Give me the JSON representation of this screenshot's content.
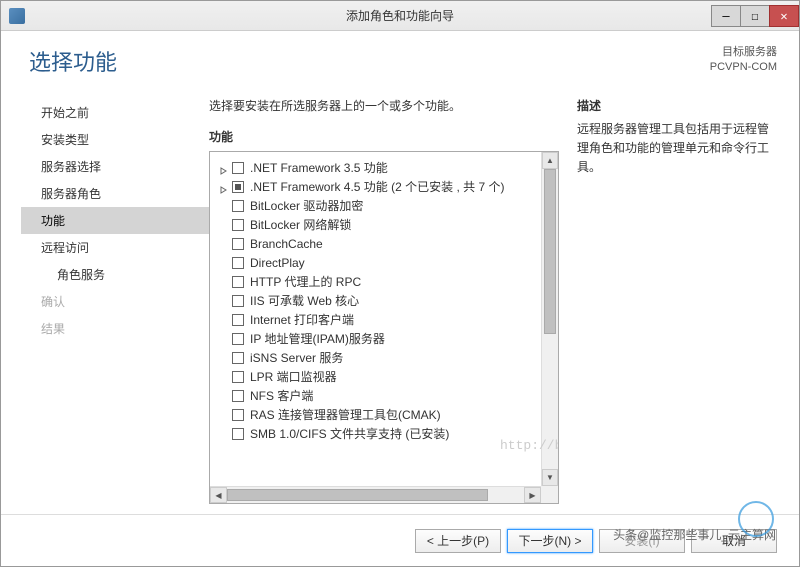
{
  "window": {
    "title": "添加角色和功能向导"
  },
  "header": {
    "page_title": "选择功能",
    "target_label": "目标服务器",
    "target_value": "PCVPN-COM"
  },
  "sidebar": {
    "items": [
      {
        "label": "开始之前",
        "active": false,
        "disabled": false,
        "indent": false
      },
      {
        "label": "安装类型",
        "active": false,
        "disabled": false,
        "indent": false
      },
      {
        "label": "服务器选择",
        "active": false,
        "disabled": false,
        "indent": false
      },
      {
        "label": "服务器角色",
        "active": false,
        "disabled": false,
        "indent": false
      },
      {
        "label": "功能",
        "active": true,
        "disabled": false,
        "indent": false
      },
      {
        "label": "远程访问",
        "active": false,
        "disabled": false,
        "indent": false
      },
      {
        "label": "角色服务",
        "active": false,
        "disabled": false,
        "indent": true
      },
      {
        "label": "确认",
        "active": false,
        "disabled": true,
        "indent": false
      },
      {
        "label": "结果",
        "active": false,
        "disabled": true,
        "indent": false
      }
    ]
  },
  "main": {
    "instruction": "选择要安装在所选服务器上的一个或多个功能。",
    "features_label": "功能",
    "desc_label": "描述",
    "desc_text": "远程服务器管理工具包括用于远程管理角色和功能的管理单元和命令行工具。",
    "features": [
      {
        "label": ".NET Framework 3.5 功能",
        "expandable": true,
        "checked": "none"
      },
      {
        "label": ".NET Framework 4.5 功能 (2 个已安装 , 共 7 个)",
        "expandable": true,
        "checked": "semi"
      },
      {
        "label": "BitLocker 驱动器加密",
        "expandable": false,
        "checked": "none"
      },
      {
        "label": "BitLocker 网络解锁",
        "expandable": false,
        "checked": "none"
      },
      {
        "label": "BranchCache",
        "expandable": false,
        "checked": "none"
      },
      {
        "label": "DirectPlay",
        "expandable": false,
        "checked": "none"
      },
      {
        "label": "HTTP 代理上的 RPC",
        "expandable": false,
        "checked": "none"
      },
      {
        "label": "IIS 可承载 Web 核心",
        "expandable": false,
        "checked": "none"
      },
      {
        "label": "Internet 打印客户端",
        "expandable": false,
        "checked": "none"
      },
      {
        "label": "IP 地址管理(IPAM)服务器",
        "expandable": false,
        "checked": "none"
      },
      {
        "label": "iSNS Server 服务",
        "expandable": false,
        "checked": "none"
      },
      {
        "label": "LPR 端口监视器",
        "expandable": false,
        "checked": "none"
      },
      {
        "label": "NFS 客户端",
        "expandable": false,
        "checked": "none"
      },
      {
        "label": "RAS 连接管理器管理工具包(CMAK)",
        "expandable": false,
        "checked": "none"
      },
      {
        "label": "SMB 1.0/CIFS 文件共享支持 (已安装)",
        "expandable": false,
        "checked": "none"
      }
    ]
  },
  "footer": {
    "prev": "< 上一步(P)",
    "next": "下一步(N) >",
    "install": "安装(I)",
    "cancel": "取消"
  },
  "watermark": "http://blog.csdn.net/pcvpn",
  "footer_watermark": "头条@监控那些事⼉_云主算网"
}
